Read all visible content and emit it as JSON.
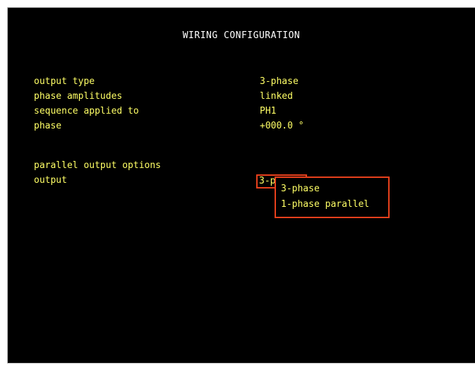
{
  "title": "WIRING CONFIGURATION",
  "fields": [
    {
      "label": "output type",
      "value": "3-phase"
    },
    {
      "label": "phase amplitudes",
      "value": "linked"
    },
    {
      "label": "sequence applied to",
      "value": "PH1"
    },
    {
      "label": "phase",
      "value": "+000.0 °"
    }
  ],
  "parallel": {
    "section_label": "parallel output options",
    "output_label": "output",
    "output_current_value": "3-phase",
    "options": [
      "3-phase",
      "1-phase parallel"
    ]
  },
  "colors": {
    "background": "#000000",
    "text": "#ffff66",
    "title": "#ffffff",
    "highlight_border": "#e8401c"
  }
}
